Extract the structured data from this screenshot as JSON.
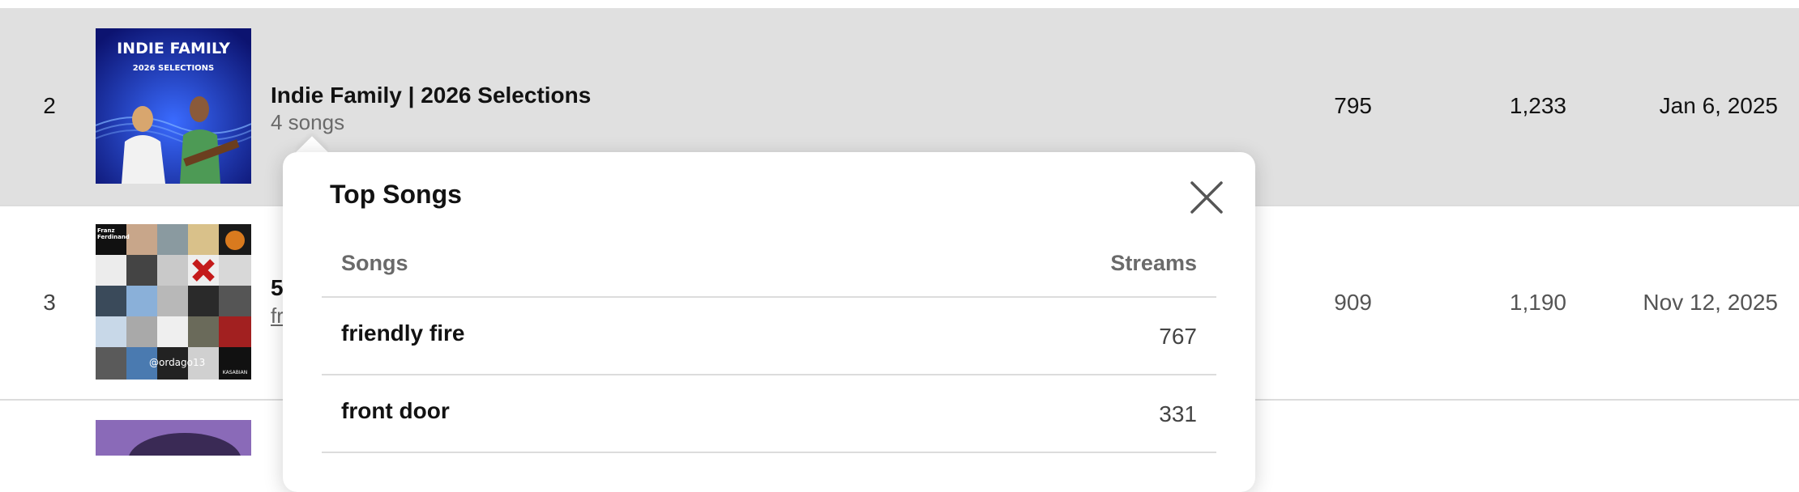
{
  "rows": [
    {
      "rank": "2",
      "title": "Indie Family | 2026 Selections",
      "subtitle": "4 songs",
      "col1": "795",
      "col2": "1,233",
      "date": "Jan 6, 2025",
      "cover_title": "INDIE FAMILY",
      "cover_sub": "2026 SELECTIONS"
    },
    {
      "rank": "3",
      "title_partial": "5",
      "subtitle_partial": "fr",
      "col1": "909",
      "col2": "1,190",
      "date": "Nov 12, 2025",
      "cover_handle": "@ordago13",
      "cover_text_1": "Franz Ferdinand",
      "cover_text_2": "KASABIAN"
    }
  ],
  "popover": {
    "title": "Top Songs",
    "col_songs": "Songs",
    "col_streams": "Streams",
    "songs": [
      {
        "name": "friendly fire",
        "streams": "767"
      },
      {
        "name": "front door",
        "streams": "331"
      }
    ]
  },
  "colors": {
    "highlight_row": "#e0e0e0",
    "cover_blue": "#1e2aa0",
    "popover_bg": "#ffffff"
  }
}
